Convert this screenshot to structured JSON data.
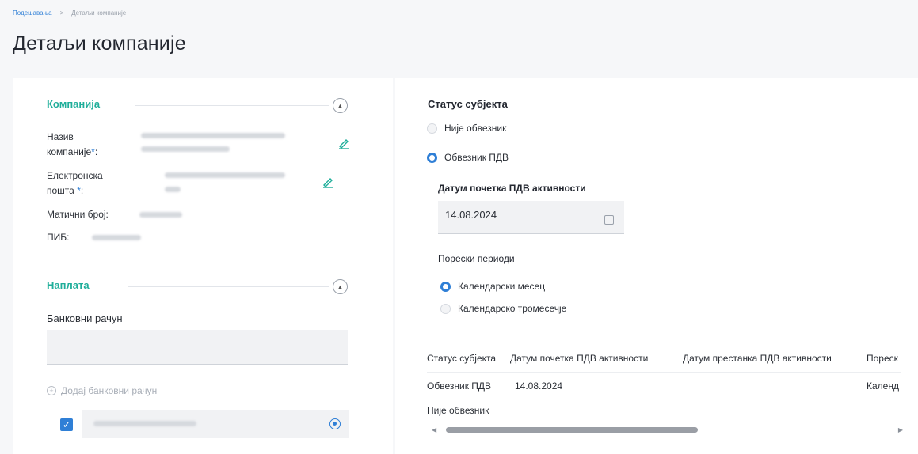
{
  "breadcrumb": {
    "parent": "Подешавања",
    "separator": ">",
    "current": "Детаљи компаније"
  },
  "page": {
    "title": "Детаљи компаније"
  },
  "company": {
    "section_title": "Компанија",
    "name_label_line1": "Назив",
    "name_label_line2": "компаније",
    "email_label_line1": "Електронска",
    "email_label_line2": "пошта",
    "required_mark": "*",
    "label_suffix": ":",
    "mb_label": "Матични број:",
    "pib_label": "ПИБ:"
  },
  "billing": {
    "section_title": "Наплата",
    "bank_label": "Банковни рачун",
    "add_bank_label": "Додај банковни рачун",
    "add_icon": "plus-circle-icon",
    "check_icon": "checkmark-icon"
  },
  "status": {
    "title": "Статус субјекта",
    "options": [
      "Није обвезник",
      "Обвезник ПДВ"
    ],
    "selected": "Обвезник ПДВ",
    "vat_start_label": "Датум почетка ПДВ активности",
    "vat_start_value": "14.08.2024",
    "tax_periods_label": "Порески периоди",
    "period_options": [
      "Календарски месец",
      "Календарско тромесечје"
    ],
    "selected_period": "Календарски месец"
  },
  "history_table": {
    "columns": [
      "Статус субјекта",
      "Датум почетка ПДВ активности",
      "Датум престанка ПДВ активности",
      "Пореск"
    ],
    "rows": [
      [
        "Обвезник ПДВ",
        "14.08.2024",
        "",
        "Календ"
      ],
      [
        "Није обвезник",
        "",
        "",
        ""
      ]
    ]
  },
  "colors": {
    "accent": "#2f7fd6",
    "section_green": "#1fae9a",
    "panel": "#ffffff",
    "background": "#f6f7f9"
  }
}
